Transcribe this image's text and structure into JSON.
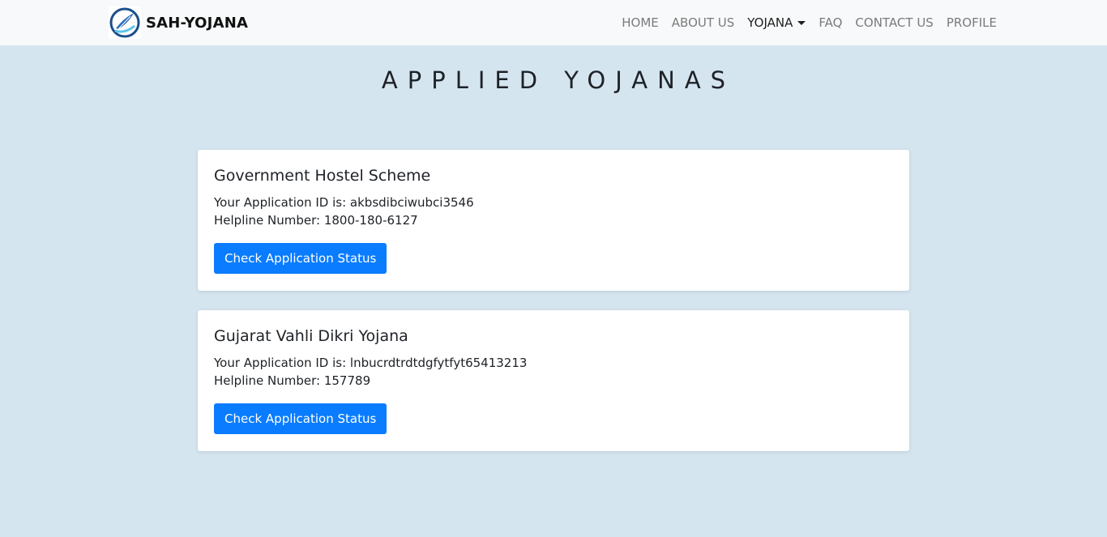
{
  "navbar": {
    "brand": "SAH-YOJANA",
    "logo_icon": "feather-circle-logo",
    "items": [
      {
        "label": "HOME"
      },
      {
        "label": "ABOUT US"
      },
      {
        "label": "YOJANA",
        "dropdown": true,
        "active": true
      },
      {
        "label": "FAQ"
      },
      {
        "label": "CONTACT US"
      },
      {
        "label": "PROFILE"
      }
    ]
  },
  "page": {
    "title": "APPLIED YOJANAS"
  },
  "cards": [
    {
      "title": "Government Hostel Scheme",
      "application_id_line": "Your Application ID is: akbsdibciwubci3546",
      "helpline_line": "Helpline Number: 1800-180-6127",
      "button_label": "Check Application Status"
    },
    {
      "title": "Gujarat Vahli Dikri Yojana",
      "application_id_line": "Your Application ID is: lnbucrdtrdtdgfytfyt65413213",
      "helpline_line": "Helpline Number: 157789",
      "button_label": "Check Application Status"
    }
  ],
  "colors": {
    "background": "#d5e5f0",
    "navbar": "#f8f9fa",
    "primary_button": "#0a7cff"
  }
}
